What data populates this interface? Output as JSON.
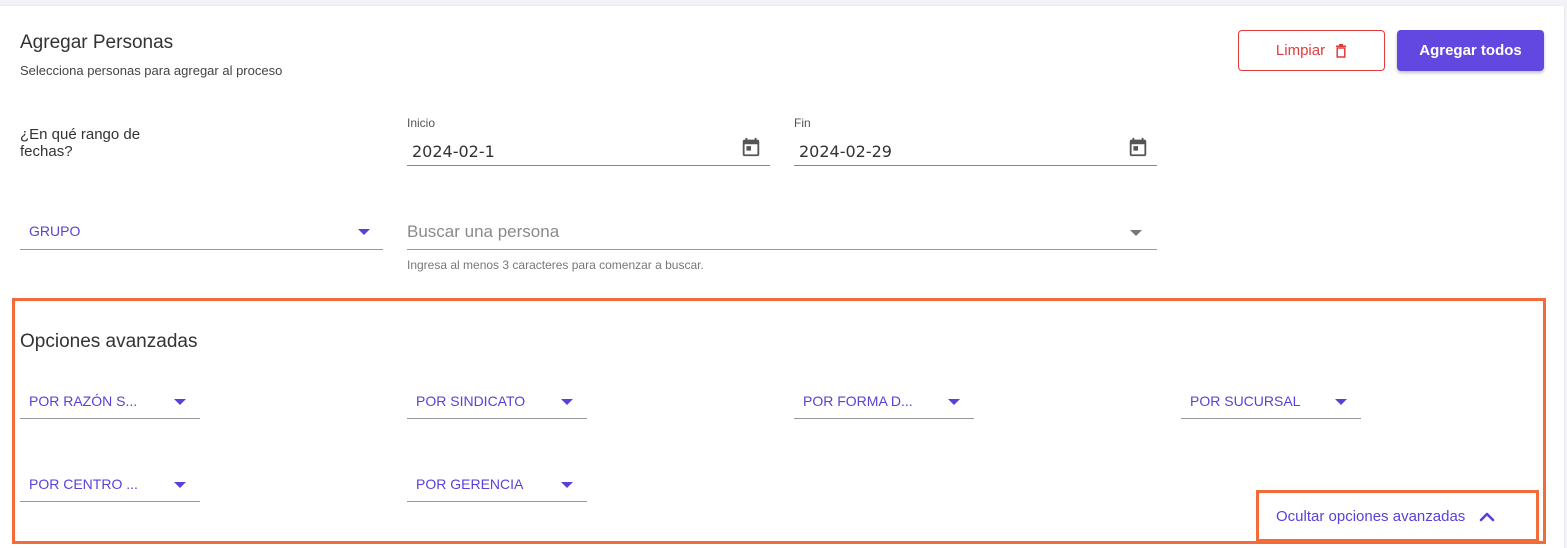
{
  "header": {
    "title": "Agregar Personas",
    "subtitle": "Selecciona personas para agregar al proceso",
    "clear_label": "Limpiar",
    "add_all_label": "Agregar todos"
  },
  "date_range": {
    "question": "¿En qué rango de fechas?",
    "start_label": "Inicio",
    "start_value": "2024-02-1",
    "end_label": "Fin",
    "end_value": "2024-02-29"
  },
  "filters": {
    "group_label": "GRUPO",
    "search_placeholder": "Buscar una persona",
    "search_hint": "Ingresa al menos 3 caracteres para comenzar a buscar."
  },
  "advanced": {
    "title": "Opciones avanzadas",
    "options": [
      "POR RAZÓN S...",
      "POR SINDICATO",
      "POR FORMA D...",
      "POR SUCURSAL",
      "POR CENTRO ...",
      "POR GERENCIA"
    ],
    "toggle_label": "Ocultar opciones avanzadas"
  },
  "colors": {
    "accent": "#5b3fd9",
    "primary_button": "#6247e0",
    "danger": "#e23b3b",
    "highlight": "#f26b38"
  },
  "icons": [
    "trash-icon",
    "calendar-icon",
    "caret-down-icon",
    "chevron-up-icon"
  ]
}
